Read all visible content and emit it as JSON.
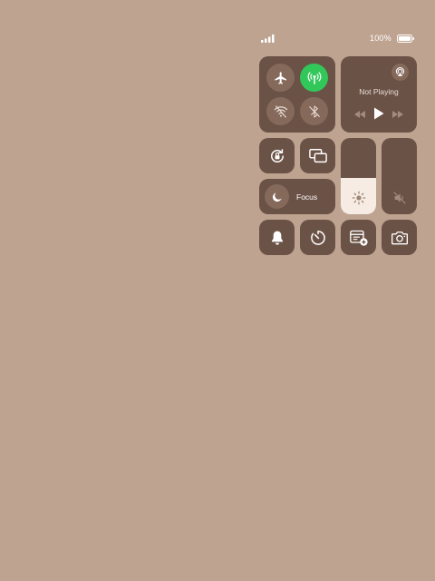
{
  "status_bar": {
    "battery_percent": "100%",
    "signal_bars": 4,
    "battery_level": 1.0
  },
  "connectivity": {
    "airplane_mode": {
      "icon": "airplane-icon",
      "on": false
    },
    "cellular_data": {
      "icon": "antenna-icon",
      "on": true
    },
    "wifi": {
      "icon": "wifi-off-icon",
      "on": false
    },
    "bluetooth": {
      "icon": "bluetooth-off-icon",
      "on": false
    }
  },
  "now_playing": {
    "title": "Not Playing",
    "airplay_icon": "airplay-icon",
    "controls": [
      "rewind-icon",
      "play-icon",
      "fast-forward-icon"
    ]
  },
  "controls": {
    "rotation_lock_icon": "rotation-lock-icon",
    "screen_mirroring_icon": "screen-mirroring-icon",
    "focus": {
      "label": "Focus",
      "icon": "moon-icon"
    },
    "brightness": {
      "level": 0.48,
      "icon": "sun-icon"
    },
    "volume": {
      "level": 0.0,
      "icon": "speaker-muted-icon"
    },
    "bottom_row": [
      "bell-icon",
      "timer-icon",
      "note-add-icon",
      "camera-icon"
    ]
  },
  "colors": {
    "wallpaper": "#bfa391",
    "tile": "#6b5246",
    "circle": "#85695b",
    "active_green": "#31c759",
    "slider_fill": "#f6ece3"
  }
}
